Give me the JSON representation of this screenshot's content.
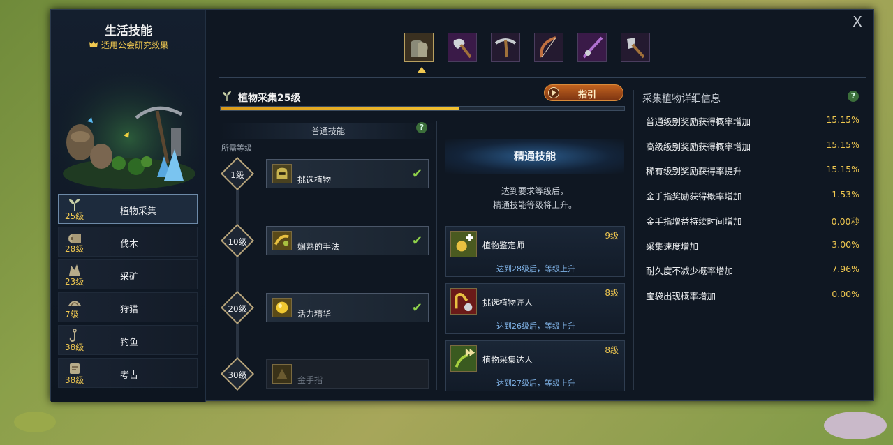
{
  "window": {
    "close_label": "X"
  },
  "left": {
    "title": "生活技能",
    "subtitle": "适用公会研究效果",
    "skills": [
      {
        "icon": "sprout-icon",
        "level": "25级",
        "name": "植物采集",
        "active": true
      },
      {
        "icon": "log-icon",
        "level": "28级",
        "name": "伐木",
        "active": false
      },
      {
        "icon": "ore-icon",
        "level": "23级",
        "name": "采矿",
        "active": false
      },
      {
        "icon": "hunting-icon",
        "level": "7级",
        "name": "狩猎",
        "active": false
      },
      {
        "icon": "hook-icon",
        "level": "38级",
        "name": "钓鱼",
        "active": false
      },
      {
        "icon": "scroll-icon",
        "level": "38级",
        "name": "考古",
        "active": false
      }
    ]
  },
  "toolbar": {
    "tools": [
      "gloves-icon",
      "axe-icon",
      "pickaxe-icon",
      "bow-icon",
      "fishing-rod-icon",
      "shovel-icon"
    ],
    "selected_index": 0
  },
  "current": {
    "title": "植物采集25级",
    "guide_label": "指引",
    "progress_fraction": 0.59
  },
  "normal": {
    "header": "普通技能",
    "help": "?",
    "req_label": "所需等级",
    "tiers": [
      {
        "level": "1级",
        "name": "挑选植物",
        "done": true
      },
      {
        "level": "10级",
        "name": "娴熟的手法",
        "done": true
      },
      {
        "level": "20级",
        "name": "活力精华",
        "done": true
      },
      {
        "level": "30级",
        "name": "金手指",
        "done": false
      }
    ],
    "check_glyph": "✔"
  },
  "mastery": {
    "header": "精通技能",
    "note_line1": "达到要求等级后，",
    "note_line2": "精通技能等级将上升。",
    "cards": [
      {
        "name": "植物鉴定师",
        "level": "9级",
        "requirement": "达到28级后，等级上升"
      },
      {
        "name": "挑选植物匠人",
        "level": "8级",
        "requirement": "达到26级后，等级上升"
      },
      {
        "name": "植物采集达人",
        "level": "8级",
        "requirement": "达到27级后，等级上升"
      }
    ]
  },
  "stats": {
    "title": "采集植物详细信息",
    "help": "?",
    "rows": [
      {
        "label": "普通级别奖励获得概率增加",
        "value": "15.15%"
      },
      {
        "label": "高级级别奖励获得概率增加",
        "value": "15.15%"
      },
      {
        "label": "稀有级别奖励获得率提升",
        "value": "15.15%"
      },
      {
        "label": "金手指奖励获得概率增加",
        "value": "1.53%"
      },
      {
        "label": "金手指增益持续时间增加",
        "value": "0.00秒"
      },
      {
        "label": "采集速度增加",
        "value": "3.00%"
      },
      {
        "label": "耐久度不减少概率增加",
        "value": "7.96%"
      },
      {
        "label": "宝袋出现概率增加",
        "value": "0.00%"
      }
    ]
  },
  "colors": {
    "accent_gold": "#f0c850",
    "check_green": "#8fd14a",
    "link_blue": "#7fb2e6"
  }
}
